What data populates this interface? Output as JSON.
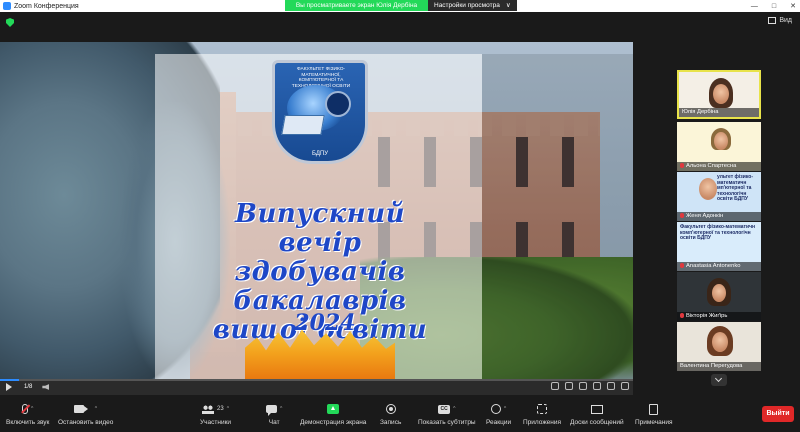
{
  "window": {
    "title": "Zoom Конференция",
    "minimize": "—",
    "maximize": "□",
    "close": "✕"
  },
  "share_bar": {
    "message": "Вы просматриваете экран Юлія Дербіна",
    "settings_label": "Настройки просмотра",
    "settings_caret": "∨"
  },
  "view": {
    "label": "Вид"
  },
  "slide": {
    "logo_text": "ФАКУЛЬТЕТ ФІЗИКО-МАТЕМАТИЧНОЇ, КОМП'ЮТЕРНОЇ ТА ТЕХНОЛОГІЧНОЇ ОСВІТИ",
    "logo_bottom": "БДПУ",
    "title": "Випускний вечір здобувачів бакалаврів вищої освіти",
    "year": "2024"
  },
  "player": {
    "page_counter": "1/8"
  },
  "participants": [
    {
      "name": "Юлія Дербіна",
      "muted": false,
      "active": true
    },
    {
      "name": "Альона Спартесна",
      "muted": true,
      "active": false
    },
    {
      "name": "Женя Адонкін",
      "muted": true,
      "active": false,
      "slide_text": "ультет фізико-математичн мп'ютерної та технологічн освіти БДПУ"
    },
    {
      "name": "Anastasia Antonenko",
      "muted": true,
      "active": false,
      "slide_text": "Факультет фізико-математичн комп'ютерної та технологічн освіти БДПУ"
    },
    {
      "name": "Вікторія Жиґірь",
      "muted": true,
      "active": false
    },
    {
      "name": "Валентина Перегудова",
      "muted": false,
      "active": false
    }
  ],
  "toolbar": {
    "mute": "Включить звук",
    "video": "Остановить видео",
    "participants": "Участники",
    "participants_count": "23",
    "chat": "Чат",
    "share": "Демонстрация экрана",
    "record": "Запись",
    "captions": "Показать субтитры",
    "reactions": "Реакции",
    "apps": "Приложения",
    "whiteboards": "Доски сообщений",
    "notes": "Примечания",
    "leave": "Выйти",
    "caret": "^"
  }
}
